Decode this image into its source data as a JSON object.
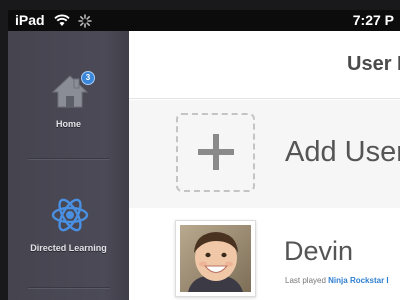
{
  "status_bar": {
    "carrier": "iPad",
    "time": "7:27 P"
  },
  "sidebar": {
    "items": [
      {
        "label": "Home",
        "icon": "home-icon",
        "badge": "3"
      },
      {
        "label": "Directed Learning",
        "icon": "atom-icon"
      }
    ]
  },
  "header": {
    "title": "User M"
  },
  "add_user": {
    "label": "Add User"
  },
  "users": [
    {
      "name": "Devin",
      "last_played_prefix": "Last played",
      "last_played_game": "Ninja Rockstar I"
    }
  ],
  "colors": {
    "sidebar": "#4a4955",
    "accent": "#2f7fd0",
    "badge": "#3a86db"
  }
}
